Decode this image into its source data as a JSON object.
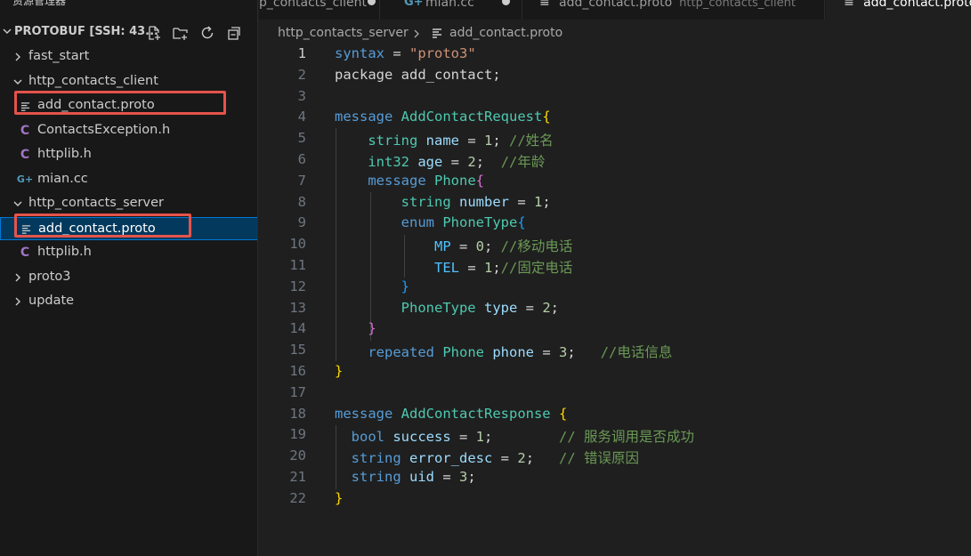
{
  "colors": {
    "accent": "#0078d4",
    "highlight_box": "#e5534b",
    "c_header_icon": "#a074c4",
    "cpp_icon": "#519aba"
  },
  "sidebar": {
    "title": "资源管理器",
    "more_label": "···",
    "section_title": "PROTOBUF [SSH: 43...",
    "actions": [
      {
        "name": "new-file-icon"
      },
      {
        "name": "new-folder-icon"
      },
      {
        "name": "refresh-icon"
      },
      {
        "name": "collapse-all-icon"
      }
    ],
    "tree": [
      {
        "label": "fast_start",
        "type": "folder",
        "expanded": false,
        "depth": 0
      },
      {
        "label": "http_contacts_client",
        "type": "folder",
        "expanded": true,
        "depth": 0
      },
      {
        "label": "add_contact.proto",
        "type": "proto",
        "depth": 1,
        "highlighted": true
      },
      {
        "label": "ContactsException.h",
        "type": "c-header",
        "icon_glyph": "C",
        "depth": 1
      },
      {
        "label": "httplib.h",
        "type": "c-header",
        "icon_glyph": "C",
        "depth": 1
      },
      {
        "label": "mian.cc",
        "type": "cpp",
        "icon_glyph": "G+",
        "depth": 1
      },
      {
        "label": "http_contacts_server",
        "type": "folder",
        "expanded": true,
        "depth": 0
      },
      {
        "label": "add_contact.proto",
        "type": "proto",
        "depth": 1,
        "highlighted": true,
        "selected": true
      },
      {
        "label": "httplib.h",
        "type": "c-header",
        "icon_glyph": "C",
        "depth": 1
      },
      {
        "label": "proto3",
        "type": "folder",
        "expanded": false,
        "depth": 0
      },
      {
        "label": "update",
        "type": "folder",
        "expanded": false,
        "depth": 0
      }
    ]
  },
  "tabs": [
    {
      "label": "p_contacts_client",
      "description": "",
      "dirty": true,
      "active": false,
      "icon": null
    },
    {
      "label": "mian.cc",
      "description": "",
      "dirty": true,
      "active": false,
      "icon": "G+"
    },
    {
      "label": "add_contact.proto",
      "description": "http_contacts_client",
      "dirty": false,
      "active": false,
      "icon": "proto"
    },
    {
      "label": "add_contact.proto",
      "description": "",
      "dirty": false,
      "active": true,
      "icon": "proto"
    }
  ],
  "breadcrumb": {
    "folder": "http_contacts_server",
    "file": "add_contact.proto"
  },
  "editor": {
    "current_line": 1,
    "lines": [
      [
        [
          "kw",
          "syntax"
        ],
        [
          "txt",
          " = "
        ],
        [
          "str",
          "\"proto3\""
        ]
      ],
      [
        [
          "txt",
          "package add_contact;"
        ]
      ],
      [],
      [
        [
          "kw",
          "message"
        ],
        [
          "txt",
          " "
        ],
        [
          "typ",
          "AddContactRequest"
        ],
        [
          "b1",
          "{"
        ]
      ],
      [
        [
          "txt",
          "    "
        ],
        [
          "typ",
          "string"
        ],
        [
          "txt",
          " "
        ],
        [
          "var",
          "name"
        ],
        [
          "txt",
          " = "
        ],
        [
          "num",
          "1"
        ],
        [
          "txt",
          "; "
        ],
        [
          "cmt",
          "//姓名"
        ]
      ],
      [
        [
          "txt",
          "    "
        ],
        [
          "typ",
          "int32"
        ],
        [
          "txt",
          " "
        ],
        [
          "var",
          "age"
        ],
        [
          "txt",
          " = "
        ],
        [
          "num",
          "2"
        ],
        [
          "txt",
          ";  "
        ],
        [
          "cmt",
          "//年龄"
        ]
      ],
      [
        [
          "txt",
          "    "
        ],
        [
          "kw",
          "message"
        ],
        [
          "txt",
          " "
        ],
        [
          "typ",
          "Phone"
        ],
        [
          "b2",
          "{"
        ]
      ],
      [
        [
          "txt",
          "        "
        ],
        [
          "typ",
          "string"
        ],
        [
          "txt",
          " "
        ],
        [
          "var",
          "number"
        ],
        [
          "txt",
          " = "
        ],
        [
          "num",
          "1"
        ],
        [
          "txt",
          ";"
        ]
      ],
      [
        [
          "txt",
          "        "
        ],
        [
          "kw",
          "enum"
        ],
        [
          "txt",
          " "
        ],
        [
          "typ",
          "PhoneType"
        ],
        [
          "b3",
          "{"
        ]
      ],
      [
        [
          "txt",
          "            "
        ],
        [
          "c",
          "MP"
        ],
        [
          "txt",
          " = "
        ],
        [
          "num",
          "0"
        ],
        [
          "txt",
          "; "
        ],
        [
          "cmt",
          "//移动电话"
        ]
      ],
      [
        [
          "txt",
          "            "
        ],
        [
          "c",
          "TEL"
        ],
        [
          "txt",
          " = "
        ],
        [
          "num",
          "1"
        ],
        [
          "txt",
          ";"
        ],
        [
          "cmt",
          "//固定电话"
        ]
      ],
      [
        [
          "txt",
          "        "
        ],
        [
          "b3",
          "}"
        ]
      ],
      [
        [
          "txt",
          "        "
        ],
        [
          "typ",
          "PhoneType"
        ],
        [
          "txt",
          " "
        ],
        [
          "var",
          "type"
        ],
        [
          "txt",
          " = "
        ],
        [
          "num",
          "2"
        ],
        [
          "txt",
          ";"
        ]
      ],
      [
        [
          "txt",
          "    "
        ],
        [
          "b2",
          "}"
        ]
      ],
      [
        [
          "txt",
          "    "
        ],
        [
          "kw",
          "repeated"
        ],
        [
          "txt",
          " "
        ],
        [
          "typ",
          "Phone"
        ],
        [
          "txt",
          " "
        ],
        [
          "var",
          "phone"
        ],
        [
          "txt",
          " = "
        ],
        [
          "num",
          "3"
        ],
        [
          "txt",
          ";   "
        ],
        [
          "cmt",
          "//电话信息"
        ]
      ],
      [
        [
          "b1",
          "}"
        ]
      ],
      [],
      [
        [
          "kw",
          "message"
        ],
        [
          "txt",
          " "
        ],
        [
          "typ",
          "AddContactResponse"
        ],
        [
          "txt",
          " "
        ],
        [
          "b1",
          "{"
        ]
      ],
      [
        [
          "txt",
          "  "
        ],
        [
          "kw",
          "bool"
        ],
        [
          "txt",
          " "
        ],
        [
          "var",
          "success"
        ],
        [
          "txt",
          " = "
        ],
        [
          "num",
          "1"
        ],
        [
          "txt",
          ";        "
        ],
        [
          "cmt",
          "// 服务调用是否成功"
        ]
      ],
      [
        [
          "txt",
          "  "
        ],
        [
          "kw",
          "string"
        ],
        [
          "txt",
          " "
        ],
        [
          "var",
          "error_desc"
        ],
        [
          "txt",
          " = "
        ],
        [
          "num",
          "2"
        ],
        [
          "txt",
          ";   "
        ],
        [
          "cmt",
          "// 错误原因"
        ]
      ],
      [
        [
          "txt",
          "  "
        ],
        [
          "kw",
          "string"
        ],
        [
          "txt",
          " "
        ],
        [
          "var",
          "uid"
        ],
        [
          "txt",
          " = "
        ],
        [
          "num",
          "3"
        ],
        [
          "txt",
          ";"
        ]
      ],
      [
        [
          "b1",
          "}"
        ]
      ]
    ]
  }
}
